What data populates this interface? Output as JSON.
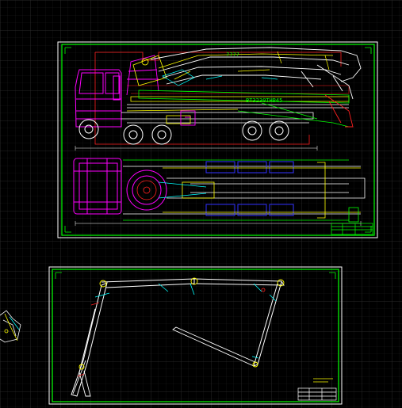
{
  "viewport": {
    "background": "#000000",
    "grid_color": "#2a2a2a",
    "major_grid_color": "#3a3a3a"
  },
  "sheets": [
    {
      "name": "truck-side-and-top-view",
      "border_color": "#00ff00",
      "labels": {
        "boom_text": "????",
        "chassis_code": "BT3230THB45"
      }
    },
    {
      "name": "boom-folded-view",
      "border_color": "#00ff00",
      "labels": {}
    }
  ],
  "colors": {
    "magenta": "#ff00ff",
    "white": "#ffffff",
    "yellow": "#ffff00",
    "cyan": "#00ffff",
    "red": "#ff2020",
    "blue": "#3030ff",
    "green": "#00ff00",
    "orange": "#ff9000"
  }
}
